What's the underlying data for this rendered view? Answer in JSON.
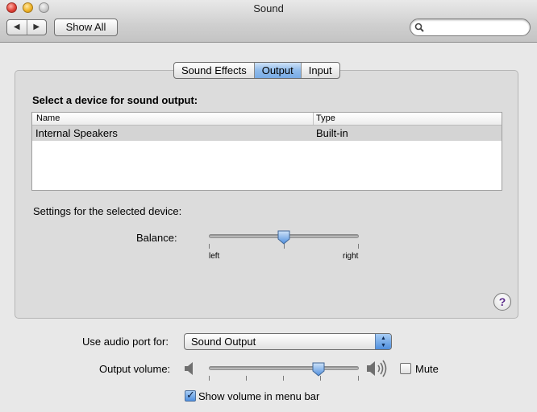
{
  "window": {
    "title": "Sound"
  },
  "toolbar": {
    "back_label": "◀",
    "forward_label": "▶",
    "show_all_label": "Show All",
    "search_placeholder": "",
    "search_value": ""
  },
  "tabs": [
    {
      "label": "Sound Effects",
      "active": false
    },
    {
      "label": "Output",
      "active": true
    },
    {
      "label": "Input",
      "active": false
    }
  ],
  "output": {
    "heading": "Select a device for sound output:",
    "columns": [
      "Name",
      "Type"
    ],
    "rows": [
      {
        "name": "Internal Speakers",
        "type": "Built-in",
        "selected": true
      }
    ],
    "settings_label": "Settings for the selected device:",
    "balance_label": "Balance:",
    "balance_left": "left",
    "balance_right": "right",
    "balance_value": 0.5
  },
  "help": {
    "label": "?"
  },
  "bottom": {
    "audio_port_label": "Use audio port for:",
    "audio_port_value": "Sound Output",
    "output_volume_label": "Output volume:",
    "output_volume_value": 0.73,
    "mute_label": "Mute",
    "mute_checked": false,
    "show_volume_label": "Show volume in menu bar",
    "show_volume_checked": true
  },
  "colors": {
    "accent": "#79ace6",
    "selection": "#d4d4d4"
  },
  "icons": [
    "search-icon",
    "speaker-low-icon",
    "speaker-high-icon",
    "help-icon",
    "popup-arrows-icon",
    "checkmark-icon"
  ]
}
